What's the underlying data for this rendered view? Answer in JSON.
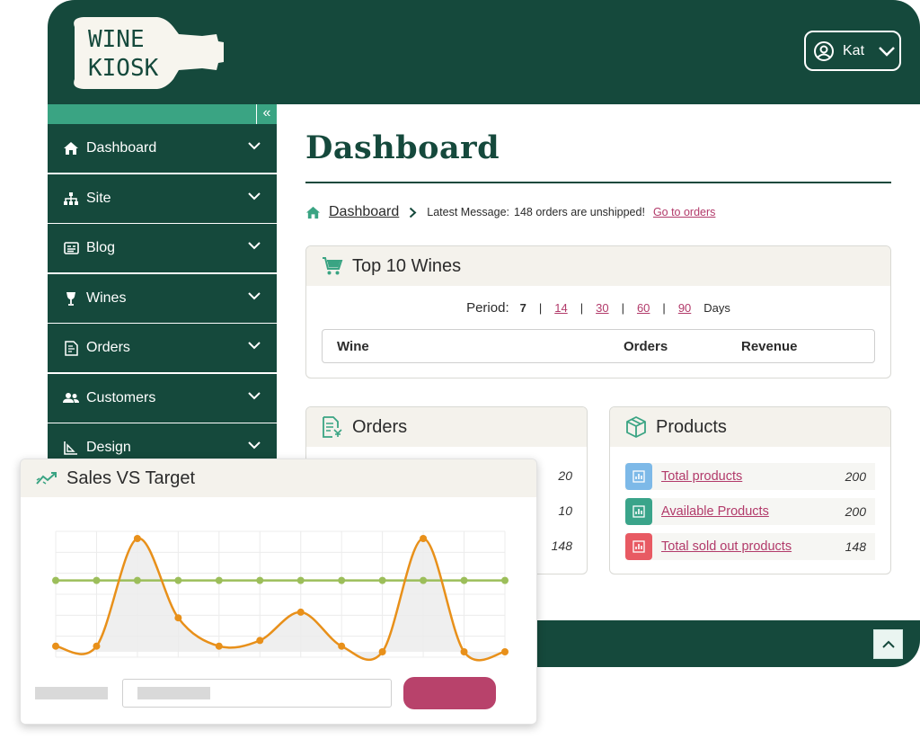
{
  "brand": {
    "logo_line1": "WINE",
    "logo_line2": "KIOSK"
  },
  "user": {
    "name": "Kat"
  },
  "sidebar": {
    "collapse_icon": "double-chevron-left-icon",
    "items": [
      {
        "label": "Dashboard",
        "icon": "home-icon"
      },
      {
        "label": "Site",
        "icon": "sitemap-icon"
      },
      {
        "label": "Blog",
        "icon": "blog-icon"
      },
      {
        "label": "Wines",
        "icon": "wine-glass-icon"
      },
      {
        "label": "Orders",
        "icon": "orders-icon"
      },
      {
        "label": "Customers",
        "icon": "users-icon"
      },
      {
        "label": "Design",
        "icon": "design-icon"
      }
    ]
  },
  "main": {
    "title": "Dashboard",
    "breadcrumb": {
      "home_label": "Dashboard",
      "message_label": "Latest Message:",
      "message": "148 orders are unshipped!",
      "link": "Go to orders"
    }
  },
  "top_wines": {
    "title": "Top 10 Wines",
    "period_label": "Period:",
    "periods": [
      "7",
      "14",
      "30",
      "60",
      "90"
    ],
    "selected_period": "7",
    "days_label": "Days",
    "columns": [
      "Wine",
      "Orders",
      "Revenue"
    ]
  },
  "orders_card": {
    "title": "Orders",
    "values": [
      "20",
      "10",
      "148"
    ]
  },
  "products_card": {
    "title": "Products",
    "rows": [
      {
        "label": "Total products",
        "value": "200",
        "color": "#7db9e8"
      },
      {
        "label": "Available Products",
        "value": "200",
        "color": "#3aa48a"
      },
      {
        "label": "Total sold out products",
        "value": "148",
        "color": "#e85a63"
      }
    ]
  },
  "sales_card": {
    "title": "Sales VS Target"
  },
  "colors": {
    "primary": "#15493c",
    "accent_green": "#3aa483",
    "link": "#b23a6a",
    "button": "#b8426b",
    "sales_line": "#e8901a",
    "target_line": "#9cbe5a"
  },
  "chart_data": {
    "type": "line",
    "title": "Sales VS Target",
    "xlabel": "",
    "ylabel": "",
    "grid": true,
    "x": [
      1,
      2,
      3,
      4,
      5,
      6,
      7,
      8,
      9,
      10,
      11,
      12
    ],
    "series": [
      {
        "values": [
          0.05,
          0.05,
          1.0,
          0.3,
          0.05,
          0.1,
          0.35,
          0.05,
          0.0,
          1.0,
          0.0,
          0.0
        ],
        "color": "#e8901a"
      },
      {
        "values": [
          0.63,
          0.63,
          0.63,
          0.63,
          0.63,
          0.63,
          0.63,
          0.63,
          0.63,
          0.63,
          0.63,
          0.63
        ],
        "color": "#9cbe5a"
      }
    ],
    "ylim": [
      0,
      1
    ]
  }
}
